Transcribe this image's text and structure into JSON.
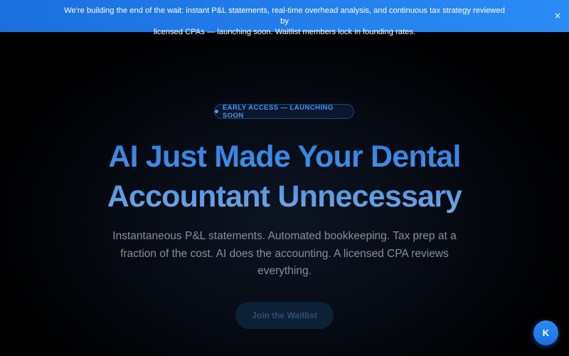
{
  "banner": {
    "line1": "We're building the end of the wait: instant P&L statements, real-time overhead analysis, and continuous tax strategy reviewed by",
    "line2": "licensed CPAs — launching soon. Waitlist members lock in founding rates.",
    "close_label": "×"
  },
  "hero": {
    "badge": "EARLY ACCESS — LAUNCHING SOON",
    "headline_line1": "AI Just Made Your Dental",
    "headline_line2": "Accountant Unnecessary",
    "subheadline": "Instantaneous P&L statements. Automated bookkeeping. Tax prep at a fraction of the cost. AI does the accounting. A licensed CPA reviews everything.",
    "cta_label": "Join the Waitlist"
  },
  "chat": {
    "avatar_letter": "K"
  },
  "colors": {
    "banner_start": "#1b6fdf",
    "banner_end": "#2a8cf5",
    "accent_blue": "#2a80e6",
    "badge_text": "#4d95ec",
    "subtext": "#8a8f98",
    "background": "#000000"
  }
}
